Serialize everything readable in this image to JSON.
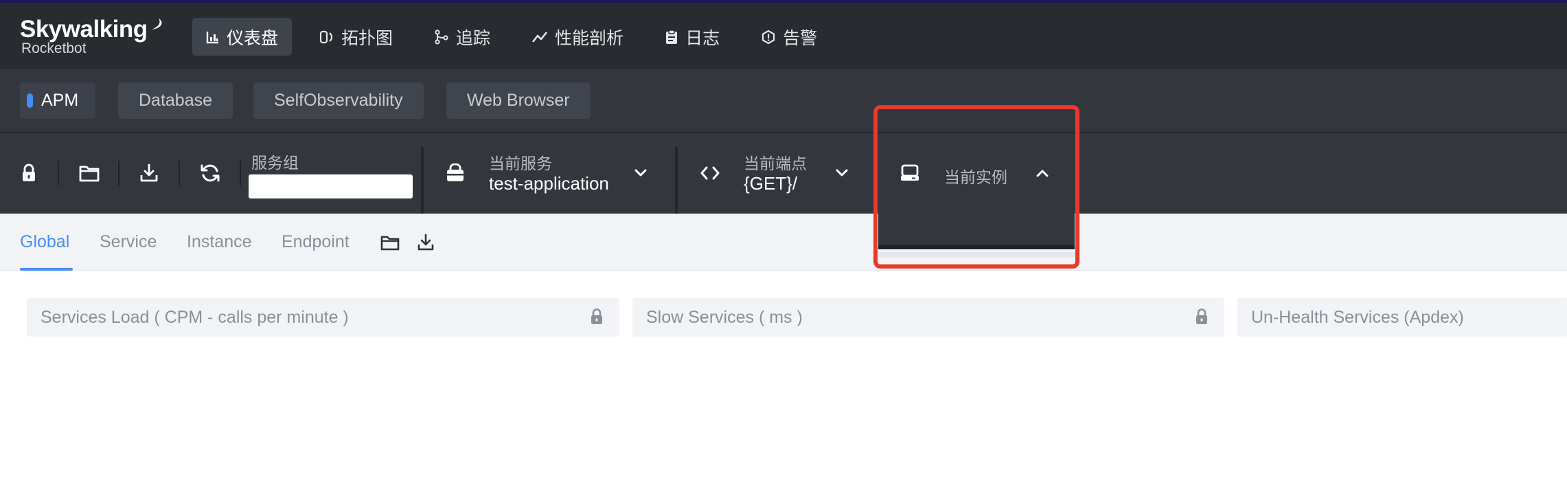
{
  "app": {
    "logo_main": "Skywalking",
    "logo_sub": "Rocketbot"
  },
  "nav": [
    {
      "label": "仪表盘",
      "icon": "bar-chart-icon",
      "active": true
    },
    {
      "label": "拓扑图",
      "icon": "topology-icon",
      "active": false
    },
    {
      "label": "追踪",
      "icon": "trace-icon",
      "active": false
    },
    {
      "label": "性能剖析",
      "icon": "trend-icon",
      "active": false
    },
    {
      "label": "日志",
      "icon": "clipboard-icon",
      "active": false
    },
    {
      "label": "告警",
      "icon": "alert-icon",
      "active": false
    }
  ],
  "layers": [
    {
      "label": "APM",
      "active": true
    },
    {
      "label": "Database",
      "active": false
    },
    {
      "label": "SelfObservability",
      "active": false
    },
    {
      "label": "Web Browser",
      "active": false
    }
  ],
  "toolbar": {
    "icons": [
      "lock-icon",
      "folder-icon",
      "download-icon",
      "refresh-icon"
    ],
    "service_group": {
      "label": "服务组",
      "value": ""
    },
    "current_service": {
      "label": "当前服务",
      "value": "test-application"
    },
    "current_endpoint": {
      "label": "当前端点",
      "value": "{GET}/"
    },
    "current_instance": {
      "label": "当前实例",
      "value": ""
    }
  },
  "dash_tabs": [
    {
      "label": "Global",
      "active": true
    },
    {
      "label": "Service",
      "active": false
    },
    {
      "label": "Instance",
      "active": false
    },
    {
      "label": "Endpoint",
      "active": false
    }
  ],
  "panels": [
    {
      "title": "Services Load ( CPM - calls per minute )",
      "locked": true
    },
    {
      "title": "Slow Services ( ms )",
      "locked": true
    },
    {
      "title": "Un-Health Services (Apdex)",
      "locked": false
    }
  ],
  "colors": {
    "accent": "#448dfe",
    "highlight": "#e8392a",
    "topbar": "#282b30",
    "toolbar": "#33363d"
  }
}
